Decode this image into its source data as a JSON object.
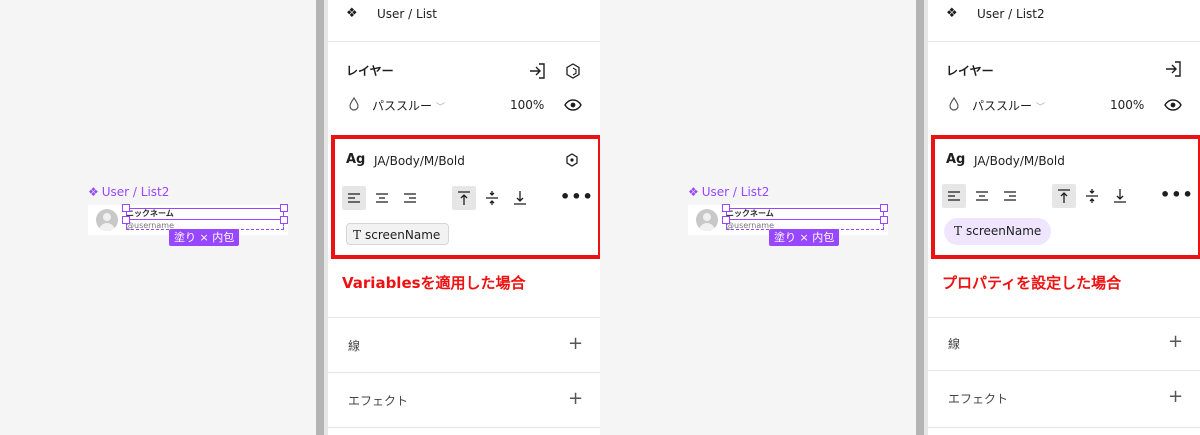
{
  "canvas": {
    "frame_label": "User / List2",
    "frame_glyph": "❖",
    "nickname": "ニックネーム",
    "username": "@username",
    "badge": "塗り × 内包"
  },
  "panels": [
    {
      "component_name": "User / List",
      "layer_title": "レイヤー",
      "blend_mode": "パススルー",
      "opacity": "100%",
      "text_style": "JA/Body/M/Bold",
      "ag": "Ag",
      "binding_chip": "screenName",
      "binding_kind": "variable",
      "caption": "Variablesを適用した場合",
      "stroke_title": "線",
      "effect_title": "エフェクト"
    },
    {
      "component_name": "User / List2",
      "layer_title": "レイヤー",
      "blend_mode": "パススルー",
      "opacity": "100%",
      "text_style": "JA/Body/M/Bold",
      "ag": "Ag",
      "binding_chip": "screenName",
      "binding_kind": "property",
      "caption": "プロパティを設定した場合",
      "stroke_title": "線",
      "effect_title": "エフェクト"
    }
  ],
  "icons": {
    "component": "component-icon",
    "detach": "detach-icon",
    "variable": "variable-hexagon-icon",
    "drop": "drop-icon",
    "eye": "eye-icon",
    "align_left": "align-left-icon",
    "align_center": "align-center-icon",
    "align_right": "align-right-icon",
    "valign_top": "align-top-icon",
    "valign_middle": "align-middle-icon",
    "valign_bottom": "align-bottom-icon",
    "more": "more-icon",
    "plus": "plus-icon"
  },
  "colors": {
    "highlight": "#ee1111",
    "component_purple": "#9747ff",
    "property_chip_bg": "#efe5ff"
  },
  "more_glyph": "•••",
  "plus_glyph": "+",
  "chip_glyph": "T"
}
